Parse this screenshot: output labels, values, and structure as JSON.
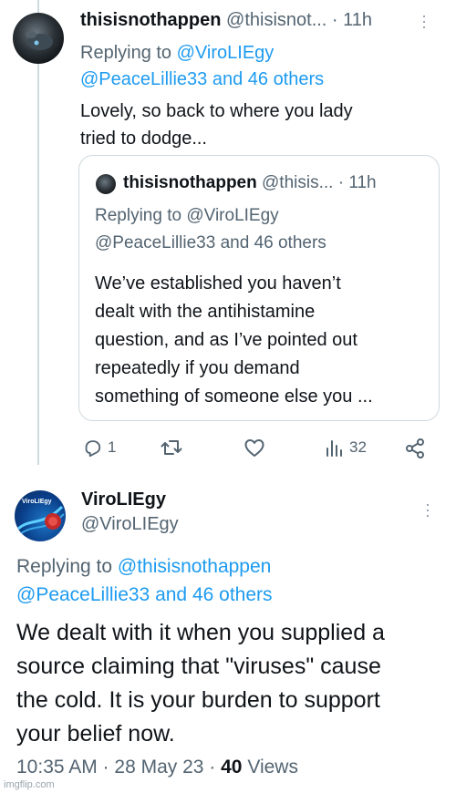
{
  "tweet1": {
    "display_name": "thisisnothappen",
    "handle_time": "@thisisnot... · 11h",
    "replying_label": "Replying to",
    "reply_to_first": "@ViroLIEgy",
    "reply_to_rest": "@PeaceLillie33 and 46 others",
    "text_line1": "Lovely, so back to where you lady",
    "text_line2": "tried to dodge...",
    "quote": {
      "display_name": "thisisnothappen",
      "handle_time": "@thisis... · 11h",
      "replying_line1": "Replying to @ViroLIEgy",
      "replying_line2": "@PeaceLillie33 and 46 others",
      "body": [
        "We’ve established you haven’t",
        "dealt with the antihistamine",
        "question, and as I’ve pointed out",
        "repeatedly if you demand",
        "something of someone else you ..."
      ]
    },
    "actions": {
      "reply_count": "1",
      "views_count": "32"
    }
  },
  "tweet2": {
    "display_name": "ViroLIEgy",
    "handle": "@ViroLIEgy",
    "avatar_text": "ViroLIEgy",
    "replying_label": "Replying to",
    "reply_to_first": "@thisisnothappen",
    "reply_to_rest": "@PeaceLillie33 and 46 others",
    "body": [
      "We dealt with it when you supplied a",
      "source claiming that \"viruses\" cause",
      "the cold. It is your burden to support",
      "your belief now."
    ],
    "meta_time": "10:35 AM · 28 May 23 ·",
    "meta_views_count": "40",
    "meta_views_label": "Views"
  },
  "watermark": "imgflip.com",
  "colors": {
    "link": "#1d9bf0",
    "muted": "#536471",
    "border": "#cfd9de"
  }
}
